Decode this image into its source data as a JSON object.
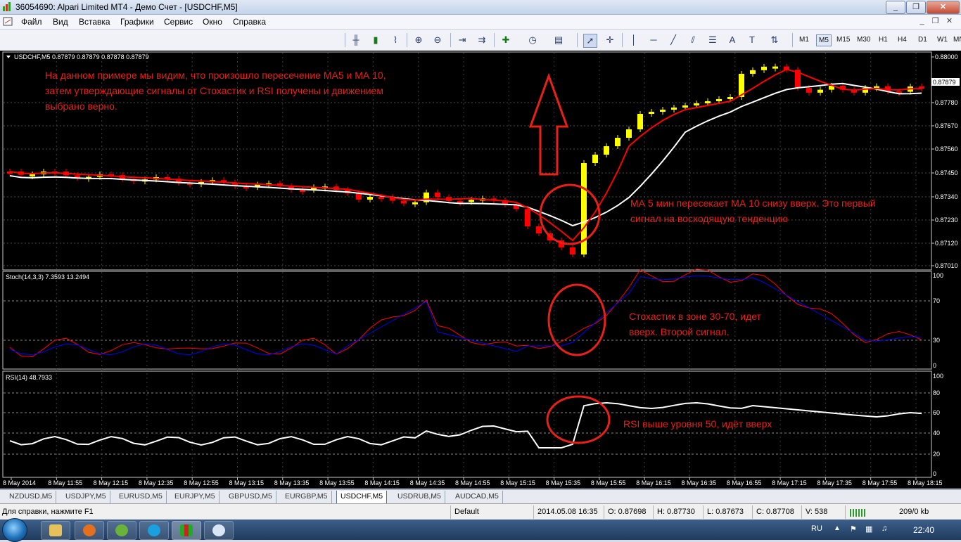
{
  "window": {
    "title": "36054690: Alpari Limited MT4 - Демо Счет - [USDCHF,M5]",
    "buttons": [
      "_",
      "❐",
      "✕"
    ]
  },
  "menu": [
    "Файл",
    "Вид",
    "Вставка",
    "Графики",
    "Сервис",
    "Окно",
    "Справка"
  ],
  "timeframes": [
    "M1",
    "M5",
    "M15",
    "M30",
    "H1",
    "H4",
    "D1",
    "W1",
    "MN"
  ],
  "active_timeframe": "M5",
  "chart": {
    "header": "USDCHF,M5  0.87879 0.87879 0.87878 0.87879",
    "current_price": "0.87879",
    "price_ticks": [
      "0.88000",
      "0.87780",
      "0.87670",
      "0.87560",
      "0.87450",
      "0.87340",
      "0.87230",
      "0.87120",
      "0.87010"
    ],
    "time_ticks": [
      "8 May 2014",
      "8 May 11:55",
      "8 May 12:15",
      "8 May 12:35",
      "8 May 12:55",
      "8 May 13:15",
      "8 May 13:35",
      "8 May 13:55",
      "8 May 14:15",
      "8 May 14:35",
      "8 May 14:55",
      "8 May 15:15",
      "8 May 15:35",
      "8 May 15:55",
      "8 May 16:15",
      "8 May 16:35",
      "8 May 16:55",
      "8 May 17:15",
      "8 May 17:35",
      "8 May 17:55",
      "8 May 18:15"
    ],
    "annotation_main": "На данном примере мы видим, что произошло пересечение МА5 и МА 10, затем утверждающие сигналы от Стохастик и RSI получены и движением выбрано верно.",
    "annotation_ma": "МА 5 мин пересекает МА 10 снизу вверх. Это первый сигнал на восходящую тенденцию",
    "colors": {
      "background": "#000000",
      "up_candle": "#ffff00",
      "down_candle": "#ff0000",
      "ma_fast": "#ff0000",
      "ma_slow": "#ffffff",
      "annotation": "#e8201a",
      "grid": "#4a4a4a"
    }
  },
  "stoch": {
    "header": "Stoch(14,3,3) 7.3593 13.2494",
    "ticks": [
      "100",
      "70",
      "30",
      "0"
    ],
    "annotation": "Стохастик в зоне 30-70, идет вверх. Второй сигнал.",
    "main_color": "#0000ff",
    "signal_color": "#ff0000"
  },
  "rsi": {
    "header": "RSI(14) 48.7933",
    "ticks": [
      "100",
      "80",
      "60",
      "40",
      "20",
      "0"
    ],
    "annotation": "RSI выше уровня 50, идёт вверх",
    "line_color": "#ffffff"
  },
  "tabs": [
    "NZDUSD,M5",
    "USDJPY,M5",
    "EURUSD,M5",
    "EURJPY,M5",
    "GBPUSD,M5",
    "EURGBP,M5",
    "USDCHF,M5",
    "USDRUB,M5",
    "AUDCAD,M5"
  ],
  "active_tab": "USDCHF,M5",
  "status": {
    "help": "Для справки, нажмите F1",
    "profile": "Default",
    "datetime": "2014.05.08 16:35",
    "open": "O: 0.87698",
    "high": "H: 0.87730",
    "low": "L: 0.87673",
    "close": "C: 0.87708",
    "volume": "V: 538",
    "traffic": "209/0 kb"
  },
  "taskbar": {
    "apps": [
      "explorer-icon",
      "firefox-icon",
      "utorrent-icon",
      "skype-icon",
      "metatrader-icon",
      "paint-icon"
    ],
    "lang": "RU",
    "time": "22:40"
  }
}
